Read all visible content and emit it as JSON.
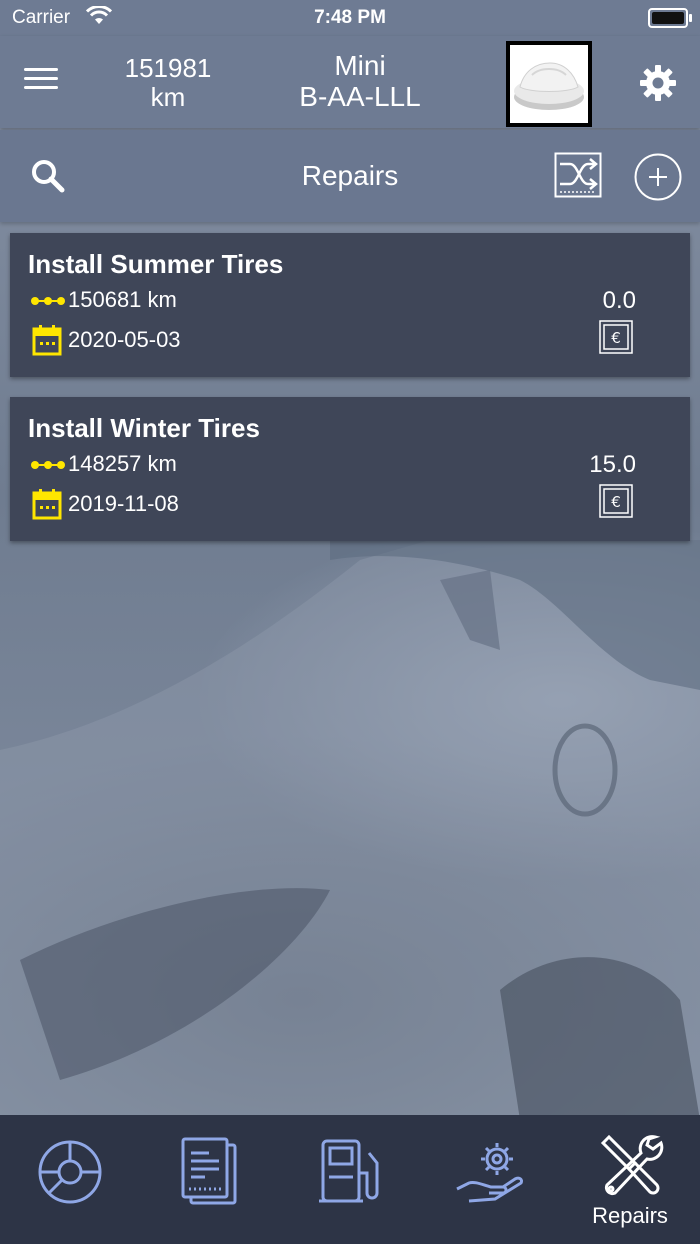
{
  "status_bar": {
    "carrier": "Carrier",
    "time": "7:48 PM"
  },
  "header": {
    "odometer_value": "151981",
    "odometer_unit": "km",
    "car_name": "Mini",
    "car_plate": "B-AA-LLL"
  },
  "subheader": {
    "title": "Repairs"
  },
  "repairs": [
    {
      "name": "Install Summer Tires",
      "km": "150681 km",
      "date": "2020-05-03",
      "cost": "0.0"
    },
    {
      "name": "Install Winter Tires",
      "km": "148257 km",
      "date": "2019-11-08",
      "cost": "15.0"
    }
  ],
  "tabs": [
    {
      "icon": "dashboard-icon",
      "label": ""
    },
    {
      "icon": "documents-icon",
      "label": ""
    },
    {
      "icon": "fuel-pump-icon",
      "label": ""
    },
    {
      "icon": "service-icon",
      "label": ""
    },
    {
      "icon": "repairs-tools-icon",
      "label": "Repairs",
      "active": true
    }
  ],
  "colors": {
    "header_bg": "#6e7b93",
    "card_bg": "#3f4658",
    "tabbar_bg": "#2d3446",
    "accent_yellow": "#ffe600",
    "tab_icon": "#8fa7e6"
  }
}
